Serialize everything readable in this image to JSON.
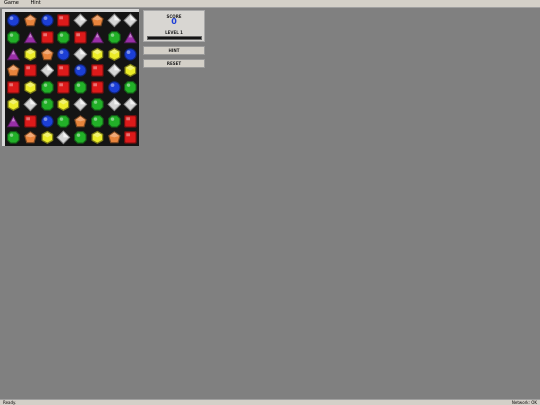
{
  "menu": {
    "items": [
      "Game",
      "Hint"
    ]
  },
  "panel": {
    "score_label": "SCORE",
    "score_value": "0",
    "level_label": "LEVEL 1",
    "level_progress": 0
  },
  "buttons": {
    "hint": "HINT",
    "reset": "RESET"
  },
  "status": {
    "left": "Ready.",
    "right": "Network: OK"
  },
  "board": {
    "rows": [
      [
        "blue",
        "orange",
        "blue",
        "red",
        "white",
        "orange",
        "white",
        "white"
      ],
      [
        "green",
        "purple",
        "red",
        "green",
        "red",
        "purple",
        "green",
        "purple"
      ],
      [
        "purple",
        "yellow",
        "orange",
        "blue",
        "white",
        "yellow",
        "yellow",
        "blue"
      ],
      [
        "orange",
        "red",
        "white",
        "red",
        "blue",
        "red",
        "white",
        "yellow"
      ],
      [
        "red",
        "yellow",
        "green",
        "red",
        "green",
        "red",
        "blue",
        "green"
      ],
      [
        "yellow",
        "white",
        "green",
        "yellow",
        "white",
        "green",
        "white",
        "white"
      ],
      [
        "purple",
        "red",
        "blue",
        "green",
        "orange",
        "green",
        "green",
        "red"
      ],
      [
        "green",
        "orange",
        "yellow",
        "white",
        "green",
        "yellow",
        "orange",
        "red"
      ]
    ]
  },
  "gem_colors": {
    "blue": "#1c3fd6",
    "orange": "#e8843c",
    "red": "#dd1a1a",
    "white": "#d6d6d6",
    "green": "#22b028",
    "purple": "#9a2fa8",
    "yellow": "#ecec28"
  }
}
